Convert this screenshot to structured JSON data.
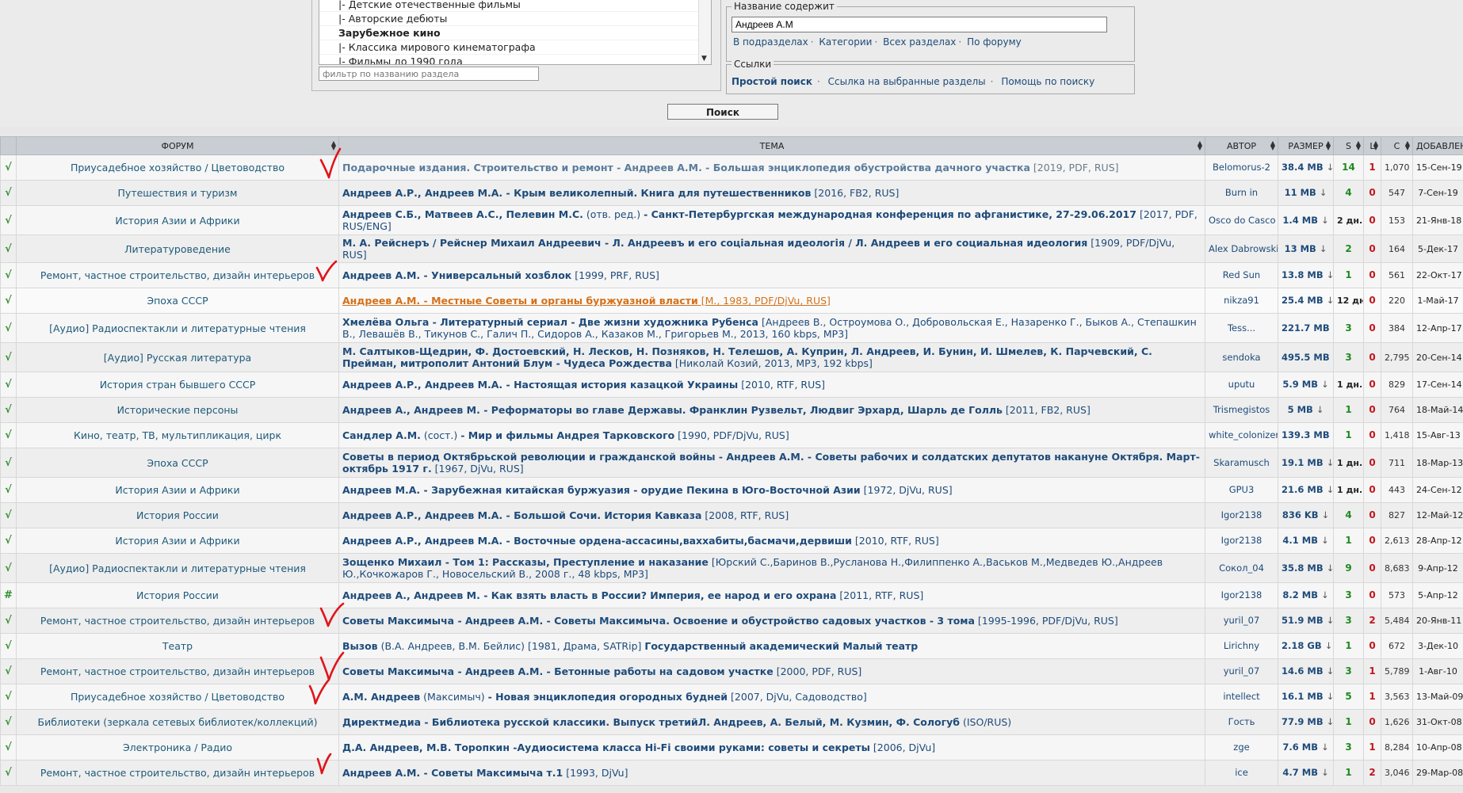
{
  "forum_list": {
    "options": [
      {
        "label": "|- Детские отечественные фильмы",
        "kind": "sub"
      },
      {
        "label": "|- Авторские дебюты",
        "kind": "sub"
      },
      {
        "label": "Зарубежное кино",
        "kind": "cat"
      },
      {
        "label": "|- Классика мирового кинематографа",
        "kind": "sub"
      },
      {
        "label": "|- Фильмы до 1990 года",
        "kind": "sub"
      }
    ],
    "filter_placeholder": "фильтр по названию раздела"
  },
  "title_box": {
    "legend": "Название содержит",
    "value": "Андреев А.М",
    "links": [
      "В подразделах",
      "Категории",
      "Всех разделах",
      "По форуму"
    ]
  },
  "links_box": {
    "legend": "Ссылки",
    "links": [
      "Простой поиск",
      "Ссылка на выбранные разделы",
      "Помощь по поиску"
    ]
  },
  "search_button": "Поиск",
  "table": {
    "headers": {
      "forum": "ФОРУМ",
      "topic": "ТЕМА",
      "author": "АВТОР",
      "size": "РАЗМЕР",
      "s": "S",
      "l": "L",
      "c": "C",
      "added": "ДОБАВЛЕН"
    },
    "size_arrow": "↓",
    "rows": [
      {
        "mark": "√",
        "forum": "Приусадебное хозяйство / Цветоводство",
        "topic": [
          {
            "c": "t",
            "v": "Подарочные издания. Строительство и ремонт - Андреев А.М. - Большая энциклопедия обустройства дачного участка"
          },
          {
            "c": "g",
            "v": " [2019, PDF, RUS]"
          }
        ],
        "author": "Belomorus-2",
        "size": "38.4 MB",
        "s": "14",
        "l": "1",
        "c": "1,070",
        "added": "15-Сен-19"
      },
      {
        "mark": "√",
        "forum": "Путешествия и туризм",
        "topic": [
          {
            "c": "t",
            "v": "Андреев А.Р., Андреев М.А. - Крым великолепный. Книга для путешественников"
          },
          {
            "c": "m",
            "v": " [2016, FB2, RUS]"
          }
        ],
        "author": "Burn in",
        "size": "11 MB",
        "s": "4",
        "l": "0",
        "c": "547",
        "added": "7-Сен-19"
      },
      {
        "mark": "√",
        "forum": "История Азии и Африки",
        "topic": [
          {
            "c": "t",
            "v": "Андреев С.Б., Матвеев А.С., Пелевин М.С."
          },
          {
            "c": "m",
            "v": " (отв. ред.) "
          },
          {
            "c": "t",
            "v": "- Санкт-Петербургская международная конференция по афганистике, 27-29.06.2017"
          },
          {
            "c": "m",
            "v": " [2017, PDF, RUS/ENG]"
          }
        ],
        "author": "Osco do Casco",
        "size": "1.4 MB",
        "s": "2 дн.",
        "l": "0",
        "c": "153",
        "added": "21-Янв-18"
      },
      {
        "mark": "√",
        "forum": "Литературоведение",
        "topic": [
          {
            "c": "t",
            "v": "М. А. Рейснеръ / Рейснер Михаил Андреевич - Л. Андреевъ и его соціальная идеологія / Л. Андреев и его социальная идеология"
          },
          {
            "c": "m",
            "v": " [1909, PDF/DjVu, RUS]"
          }
        ],
        "author": "Alex Dabrowski",
        "size": "13 MB",
        "s": "2",
        "l": "0",
        "c": "164",
        "added": "5-Дек-17"
      },
      {
        "mark": "√",
        "forum": "Ремонт, частное строительство, дизайн интерьеров",
        "topic": [
          {
            "c": "t",
            "v": "Андреев А.М. - Универсальный хозблок"
          },
          {
            "c": "m",
            "v": " [1999, PRF, RUS]"
          }
        ],
        "author": "Red Sun",
        "size": "13.8 MB",
        "s": "1",
        "l": "0",
        "c": "561",
        "added": "22-Окт-17"
      },
      {
        "mark": "√",
        "forum": "Эпоха СССР",
        "topic": [
          {
            "c": "t",
            "v": "Андреев А.М. - Местные Советы и органы буржуазной власти"
          },
          {
            "c": "m",
            "v": " [М., 1983, PDF/DjVu, RUS]"
          }
        ],
        "author": "nikza91",
        "size": "25.4 MB",
        "s": "12 дн.",
        "l": "0",
        "c": "220",
        "added": "1-Май-17"
      },
      {
        "mark": "√",
        "forum": "[Аудио] Радиоспектакли и литературные чтения",
        "topic": [
          {
            "c": "t",
            "v": "Хмелёва Ольга - Литературный сериал - Две жизни художника Рубенса"
          },
          {
            "c": "m",
            "v": " [Андреев В., Остроумова О., Добровольская Е., Назаренко Г., Быков А., Степашкин В., Левашёв В., Тикунов С., Галич П., Сидоров А., Казаков М., Григорьев М., 2013, 160 kbps, MP3]"
          }
        ],
        "author": "Tess...",
        "size": "221.7 MB",
        "s": "3",
        "l": "0",
        "c": "384",
        "added": "12-Апр-17"
      },
      {
        "mark": "√",
        "forum": "[Аудио] Русская литература",
        "topic": [
          {
            "c": "t",
            "v": "М. Салтыков-Щедрин, Ф. Достоевский, Н. Лесков, Н. Позняков, Н. Телешов, А. Куприн, Л. Андреев, И. Бунин, И. Шмелев, К. Парчевский, С. Прейман, митрополит Антоний Блум - Чудеса Рождества"
          },
          {
            "c": "m",
            "v": " [Николай Козий, 2013, MP3, 192 kbps]"
          }
        ],
        "author": "sendoka",
        "size": "495.5 MB",
        "s": "3",
        "l": "0",
        "c": "2,795",
        "added": "20-Сен-14"
      },
      {
        "mark": "√",
        "forum": "История стран бывшего СССР",
        "topic": [
          {
            "c": "t",
            "v": "Андреев А.Р., Андреев М.А. - Настоящая история казацкой Украины"
          },
          {
            "c": "m",
            "v": " [2010, RTF, RUS]"
          }
        ],
        "author": "uputu",
        "size": "5.9 MB",
        "s": "1 дн.",
        "l": "0",
        "c": "829",
        "added": "17-Сен-14"
      },
      {
        "mark": "√",
        "forum": "Исторические персоны",
        "topic": [
          {
            "c": "t",
            "v": "Андреев А., Андреев М. - Реформаторы во главе Державы. Франклин Рузвельт, Людвиг Эрхард, Шарль де Голль"
          },
          {
            "c": "m",
            "v": " [2011, FB2, RUS]"
          }
        ],
        "author": "Trismegistos",
        "size": "5 MB",
        "s": "1",
        "l": "0",
        "c": "764",
        "added": "18-Май-14"
      },
      {
        "mark": "√",
        "forum": "Кино, театр, ТВ, мультипликация, цирк",
        "topic": [
          {
            "c": "t",
            "v": "Сандлер А.М."
          },
          {
            "c": "m",
            "v": " (сост.) "
          },
          {
            "c": "t",
            "v": "- Мир и фильмы Андрея Тарковского"
          },
          {
            "c": "m",
            "v": " [1990, PDF/DjVu, RUS]"
          }
        ],
        "author": "white_colonizer",
        "size": "139.3 MB",
        "s": "1",
        "l": "0",
        "c": "1,418",
        "added": "15-Авг-13"
      },
      {
        "mark": "√",
        "forum": "Эпоха СССР",
        "topic": [
          {
            "c": "t",
            "v": "Советы в период Октябрьской революции и гражданской войны - Андреев А.М. - Советы рабочих и солдатских депутатов накануне Октября. Март-октябрь 1917 г."
          },
          {
            "c": "m",
            "v": " [1967, DjVu, RUS]"
          }
        ],
        "author": "Skaramusch",
        "size": "19.1 MB",
        "s": "1 дн.",
        "l": "0",
        "c": "711",
        "added": "18-Мар-13"
      },
      {
        "mark": "√",
        "forum": "История Азии и Африки",
        "topic": [
          {
            "c": "t",
            "v": "Андреев М.А. - Зарубежная китайская буржуазия - орудие Пекина в Юго-Восточной Азии"
          },
          {
            "c": "m",
            "v": " [1972, DjVu, RUS]"
          }
        ],
        "author": "GPU3",
        "size": "21.6 MB",
        "s": "1 дн.",
        "l": "0",
        "c": "443",
        "added": "24-Сен-12"
      },
      {
        "mark": "√",
        "forum": "История России",
        "topic": [
          {
            "c": "t",
            "v": "Андреев А.Р., Андреев М.А. - Большой Сочи. История Кавказа"
          },
          {
            "c": "m",
            "v": " [2008, RTF, RUS]"
          }
        ],
        "author": "Igor2138",
        "size": "836 KB",
        "s": "4",
        "l": "0",
        "c": "827",
        "added": "12-Май-12"
      },
      {
        "mark": "√",
        "forum": "История Азии и Африки",
        "topic": [
          {
            "c": "t",
            "v": "Андреев А.Р., Андреев М.А. - Восточные ордена-ассасины,ваххабиты,басмачи,дервиши"
          },
          {
            "c": "m",
            "v": " [2010, RTF, RUS]"
          }
        ],
        "author": "Igor2138",
        "size": "4.1 MB",
        "s": "1",
        "l": "0",
        "c": "2,613",
        "added": "28-Апр-12"
      },
      {
        "mark": "√",
        "forum": "[Аудио] Радиоспектакли и литературные чтения",
        "topic": [
          {
            "c": "t",
            "v": "Зощенко Михаил - Том 1: Рассказы, Преступление и наказание"
          },
          {
            "c": "m",
            "v": " [Юрский С.,Баринов В.,Русланова Н.,Филиппенко А.,Васьков М.,Медведев Ю.,Андреев Ю.,Кочкожаров Г., Новосельский В., 2008 г., 48 kbps, MP3]"
          }
        ],
        "author": "Сокол_04",
        "size": "35.8 MB",
        "s": "9",
        "l": "0",
        "c": "8,683",
        "added": "9-Апр-12"
      },
      {
        "mark": "#",
        "forum": "История России",
        "topic": [
          {
            "c": "t",
            "v": "Андреев А., Андреев М. - Как взять власть в России? Империя, ее народ и его охрана"
          },
          {
            "c": "m",
            "v": " [2011, RTF, RUS]"
          }
        ],
        "author": "Igor2138",
        "size": "8.2 MB",
        "s": "3",
        "l": "0",
        "c": "573",
        "added": "5-Апр-12"
      },
      {
        "mark": "√",
        "forum": "Ремонт, частное строительство, дизайн интерьеров",
        "topic": [
          {
            "c": "t",
            "v": "Советы Максимыча - Андреев А.М. - Советы Максимыча. Освоение и обустройство садовых участков - 3 тома"
          },
          {
            "c": "m",
            "v": " [1995-1996, PDF/DjVu, RUS]"
          }
        ],
        "author": "yuril_07",
        "size": "51.9 MB",
        "s": "3",
        "l": "2",
        "c": "5,484",
        "added": "20-Янв-11"
      },
      {
        "mark": "√",
        "forum": "Театр",
        "topic": [
          {
            "c": "t",
            "v": "Вызов"
          },
          {
            "c": "m",
            "v": " (В.А. Андреев, В.М. Бейлис) [1981, Драма, SATRip] "
          },
          {
            "c": "t",
            "v": "Государственный академический Малый театр"
          }
        ],
        "author": "Lirichny",
        "size": "2.18 GB",
        "s": "1",
        "l": "0",
        "c": "672",
        "added": "3-Дек-10"
      },
      {
        "mark": "√",
        "forum": "Ремонт, частное строительство, дизайн интерьеров",
        "topic": [
          {
            "c": "t",
            "v": "Советы Максимыча - Андреев А.М. - Бетонные работы на садовом участке"
          },
          {
            "c": "m",
            "v": " [2000, PDF, RUS]"
          }
        ],
        "author": "yuril_07",
        "size": "14.6 MB",
        "s": "3",
        "l": "1",
        "c": "5,789",
        "added": "1-Авг-10"
      },
      {
        "mark": "√",
        "forum": "Приусадебное хозяйство / Цветоводство",
        "topic": [
          {
            "c": "t",
            "v": "А.М. Андреев"
          },
          {
            "c": "m",
            "v": " (Максимыч) "
          },
          {
            "c": "t",
            "v": "- Новая энциклопедия огородных будней"
          },
          {
            "c": "m",
            "v": " [2007, DjVu, Садоводство]"
          }
        ],
        "author": "intellect",
        "size": "16.1 MB",
        "s": "5",
        "l": "1",
        "c": "3,563",
        "added": "13-Май-09"
      },
      {
        "mark": "√",
        "forum": "Библиотеки (зеркала сетевых библиотек/коллекций)",
        "topic": [
          {
            "c": "t",
            "v": "Директмедиа - Библиотека русской классики. Выпуск третийЛ. Андреев, А. Белый, М. Кузмин, Ф. Сологуб"
          },
          {
            "c": "m",
            "v": " (ISO/RUS)"
          }
        ],
        "author": "Гость",
        "size": "77.9 MB",
        "s": "1",
        "l": "0",
        "c": "1,626",
        "added": "31-Окт-08"
      },
      {
        "mark": "√",
        "forum": "Электроника / Радио",
        "topic": [
          {
            "c": "t",
            "v": "Д.А. Андреев, М.В. Торопкин -Аудиосистема класса Hi-Fi своими руками: советы и секреты"
          },
          {
            "c": "m",
            "v": " [2006, DjVu]"
          }
        ],
        "author": "zge",
        "size": "7.6 MB",
        "s": "3",
        "l": "1",
        "c": "8,284",
        "added": "10-Апр-08"
      },
      {
        "mark": "√",
        "forum": "Ремонт, частное строительство, дизайн интерьеров",
        "topic": [
          {
            "c": "t",
            "v": "Андреев А.М. - Советы Максимыча т.1"
          },
          {
            "c": "m",
            "v": " [1993, DjVu]"
          }
        ],
        "author": "ice",
        "size": "4.7 MB",
        "s": "1",
        "l": "2",
        "c": "3,046",
        "added": "29-Мар-08"
      }
    ]
  }
}
